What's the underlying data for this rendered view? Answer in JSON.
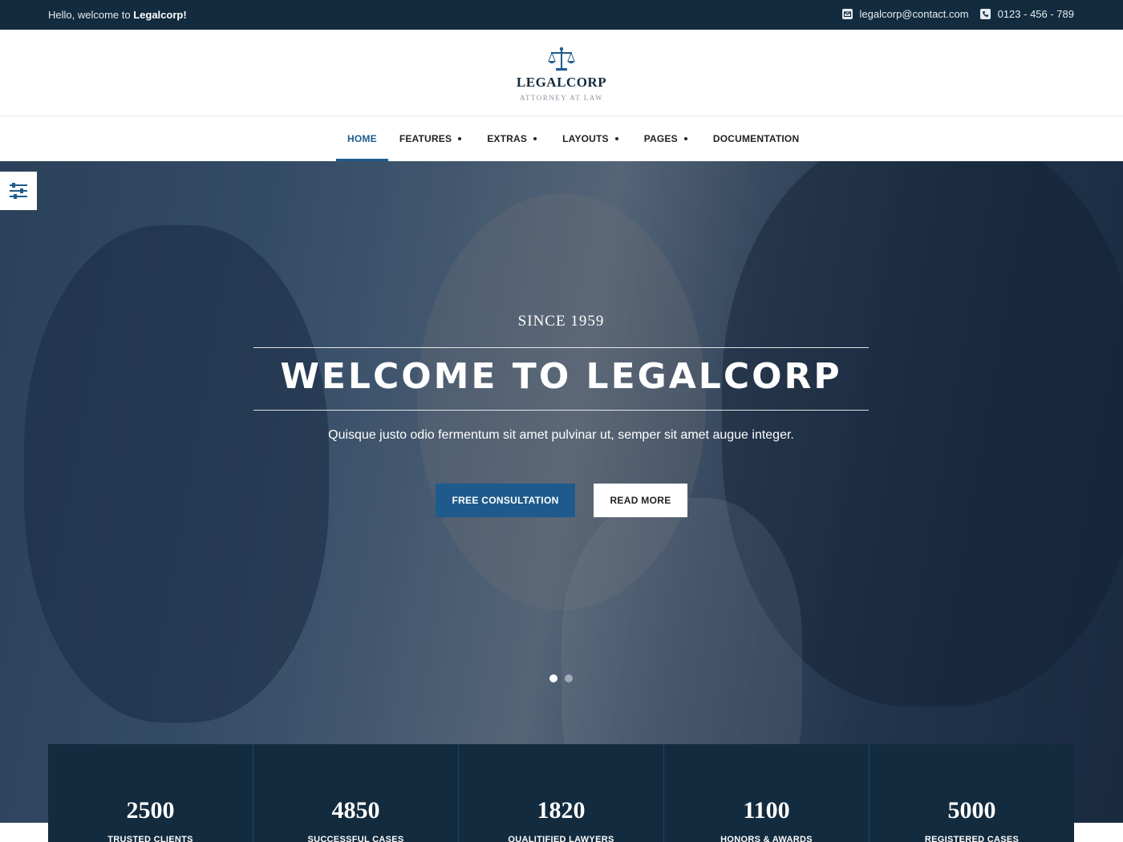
{
  "topbar": {
    "greeting_prefix": "Hello, welcome to ",
    "greeting_brand": "Legalcorp!",
    "email": "legalcorp@contact.com",
    "phone": "0123 - 456 - 789",
    "email_icon": "envelope-icon",
    "phone_icon": "phone-icon"
  },
  "logo": {
    "icon": "scales-of-justice-icon",
    "name": "LEGALCORP",
    "tagline": "ATTORNEY AT LAW"
  },
  "nav": {
    "items": [
      {
        "label": "HOME",
        "active": true,
        "has_submenu": false
      },
      {
        "label": "FEATURES",
        "active": false,
        "has_submenu": true
      },
      {
        "label": "EXTRAS",
        "active": false,
        "has_submenu": true
      },
      {
        "label": "LAYOUTS",
        "active": false,
        "has_submenu": true
      },
      {
        "label": "PAGES",
        "active": false,
        "has_submenu": true
      },
      {
        "label": "DOCUMENTATION",
        "active": false,
        "has_submenu": false
      }
    ]
  },
  "side_panel": {
    "icon": "sliders-icon"
  },
  "hero": {
    "kicker": "SINCE 1959",
    "title": "WELCOME TO LEGALCORP",
    "subtitle": "Quisque justo odio fermentum sit amet pulvinar ut, semper sit amet augue integer.",
    "primary_button": "FREE CONSULTATION",
    "secondary_button": "READ MORE",
    "slides": 2,
    "active_slide": 1
  },
  "stats": [
    {
      "value": "2500",
      "label": "TRUSTED CLIENTS"
    },
    {
      "value": "4850",
      "label": "SUCCESSFUL CASES"
    },
    {
      "value": "1820",
      "label": "QUALITIFIED LAWYERS"
    },
    {
      "value": "1100",
      "label": "HONORS & AWARDS"
    },
    {
      "value": "5000",
      "label": "REGISTERED CASES"
    }
  ],
  "colors": {
    "navy": "#122b3e",
    "accent": "#1e5b8c",
    "white": "#ffffff"
  }
}
